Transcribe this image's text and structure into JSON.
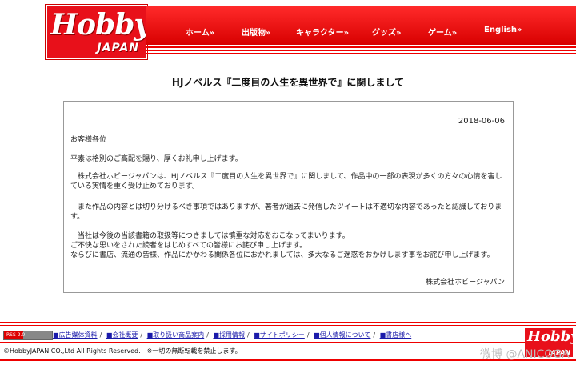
{
  "logo": {
    "hobby": "Hobby",
    "japan": "JAPAN"
  },
  "nav": [
    {
      "label": "ホーム»"
    },
    {
      "label": "出版物»"
    },
    {
      "label": "キャラクター»"
    },
    {
      "label": "グッズ»"
    },
    {
      "label": "ゲーム»"
    },
    {
      "label": "English»"
    }
  ],
  "page_title": "HJノベルス『二度目の人生を異世界で』に関しまして",
  "notice": {
    "date": "2018-06-06",
    "greeting": "お客様各位",
    "p1": "平素は格別のご高配を賜り、厚くお礼申し上げます。",
    "p2": "　株式会社ホビージャパンは、HJノベルス『二度目の人生を異世界で』に関しまして、作品中の一部の表現が多くの方々の心情を害している実情を重く受け止めております。",
    "p3": "　また作品の内容とは切り分けるべき事項ではありますが、著者が過去に発信したツイートは不適切な内容であったと認識しております。",
    "p4a": "　当社は今後の当該書籍の取扱等につきましては慎重な対応をおこなってまいります。",
    "p4b": "ご不快な思いをされた読者をはじめすべての皆様にお詫び申し上げます。",
    "p4c": "ならびに書店、流通の皆様、作品にかかわる関係各位におかれましては、多大なるご迷惑をおかけします事をお詫び申し上げます。",
    "signature": "株式会社ホビージャパン"
  },
  "footer": {
    "badge": "RSS 2.0",
    "links": [
      {
        "label": "■広告媒体資料"
      },
      {
        "label": "■会社概要"
      },
      {
        "label": "■取り扱い商品案内"
      },
      {
        "label": "■採用情報"
      },
      {
        "label": "■サイトポリシー"
      },
      {
        "label": "■個人情報について"
      },
      {
        "label": "■書店様へ"
      }
    ],
    "separator": "/",
    "copyright": "©HobbyJAPAN CO.,Ltd All Rights Reserved.　※一切の無断転載を禁止します。",
    "watermark": "微博 @ANICOGA"
  }
}
